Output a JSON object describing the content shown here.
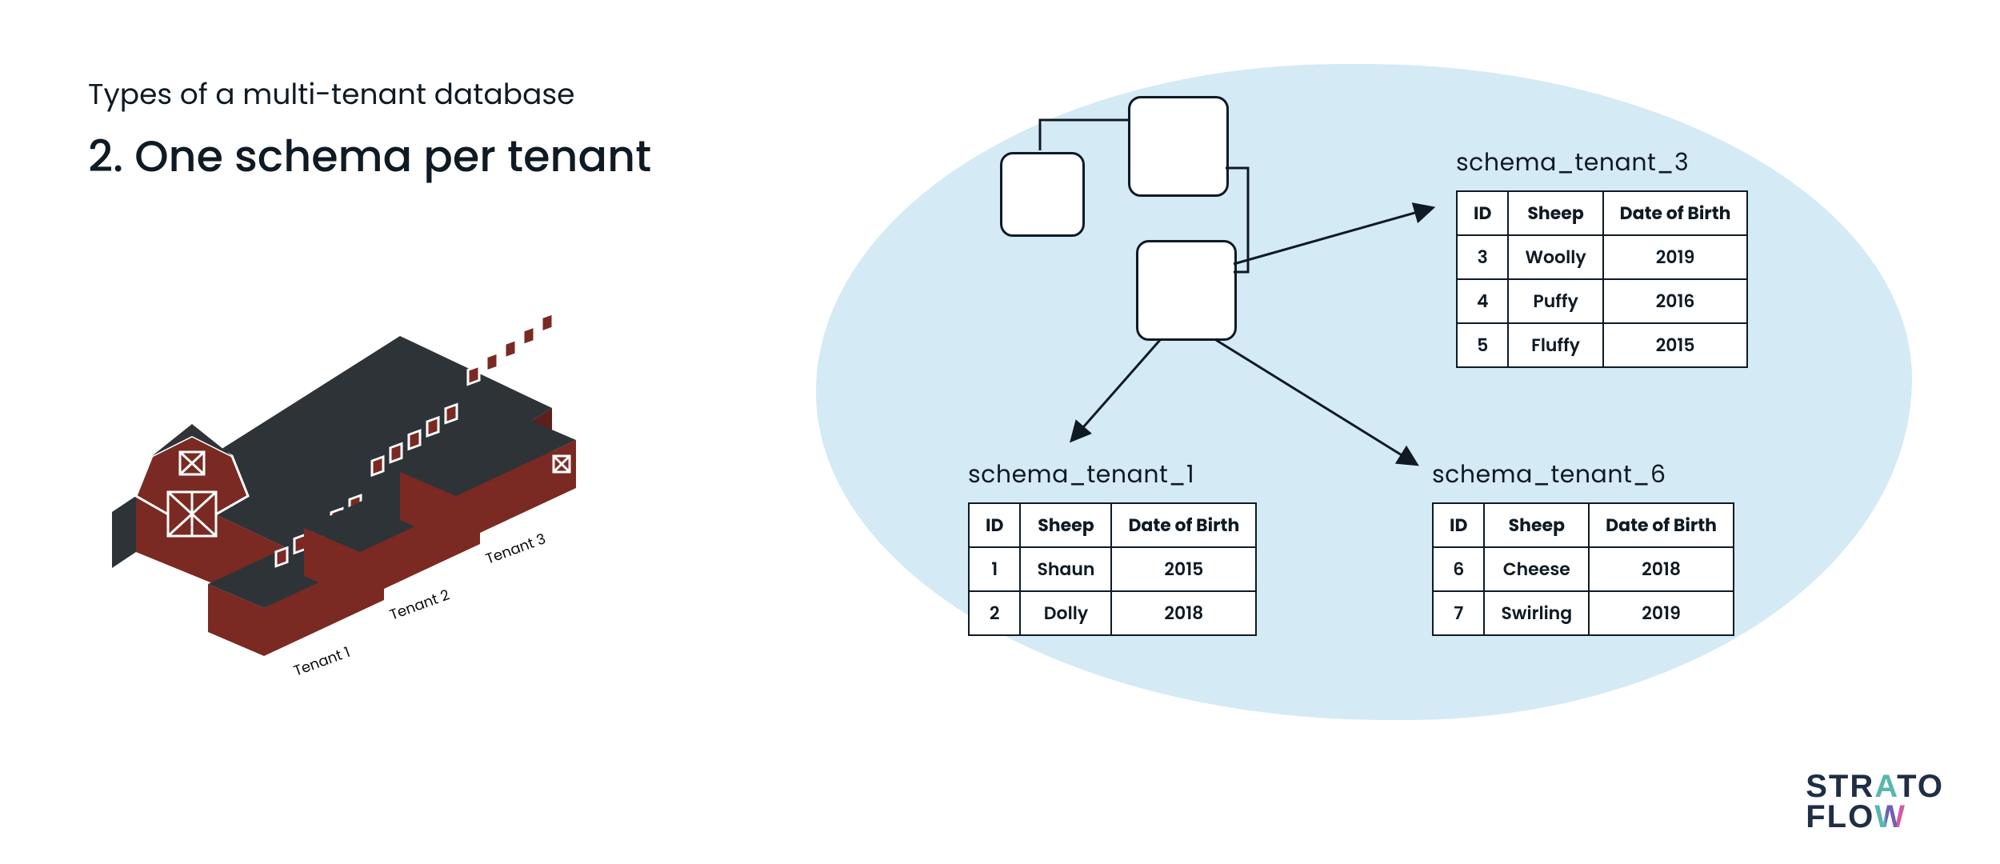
{
  "titles": {
    "overline": "Types of a multi-tenant database",
    "headline": "2. One schema per tenant"
  },
  "barn": {
    "labels": [
      "Tenant 1",
      "Tenant 2",
      "Tenant 3"
    ]
  },
  "schemas": {
    "columns": [
      "ID",
      "Sheep",
      "Date of Birth"
    ],
    "tenant3": {
      "title": "schema_tenant_3",
      "rows": [
        {
          "id": "3",
          "sheep": "Woolly",
          "dob": "2019"
        },
        {
          "id": "4",
          "sheep": "Puffy",
          "dob": "2016"
        },
        {
          "id": "5",
          "sheep": "Fluffy",
          "dob": "2015"
        }
      ]
    },
    "tenant1": {
      "title": "schema_tenant_1",
      "rows": [
        {
          "id": "1",
          "sheep": "Shaun",
          "dob": "2015"
        },
        {
          "id": "2",
          "sheep": "Dolly",
          "dob": "2018"
        }
      ]
    },
    "tenant6": {
      "title": "schema_tenant_6",
      "rows": [
        {
          "id": "6",
          "sheep": "Cheese",
          "dob": "2018"
        },
        {
          "id": "7",
          "sheep": "Swirling",
          "dob": "2019"
        }
      ]
    }
  },
  "logo": {
    "line1_pre": "STR",
    "line1_accent": "A",
    "line1_post": "TO",
    "line2_pre": "FLO",
    "line2_accent": "W"
  }
}
